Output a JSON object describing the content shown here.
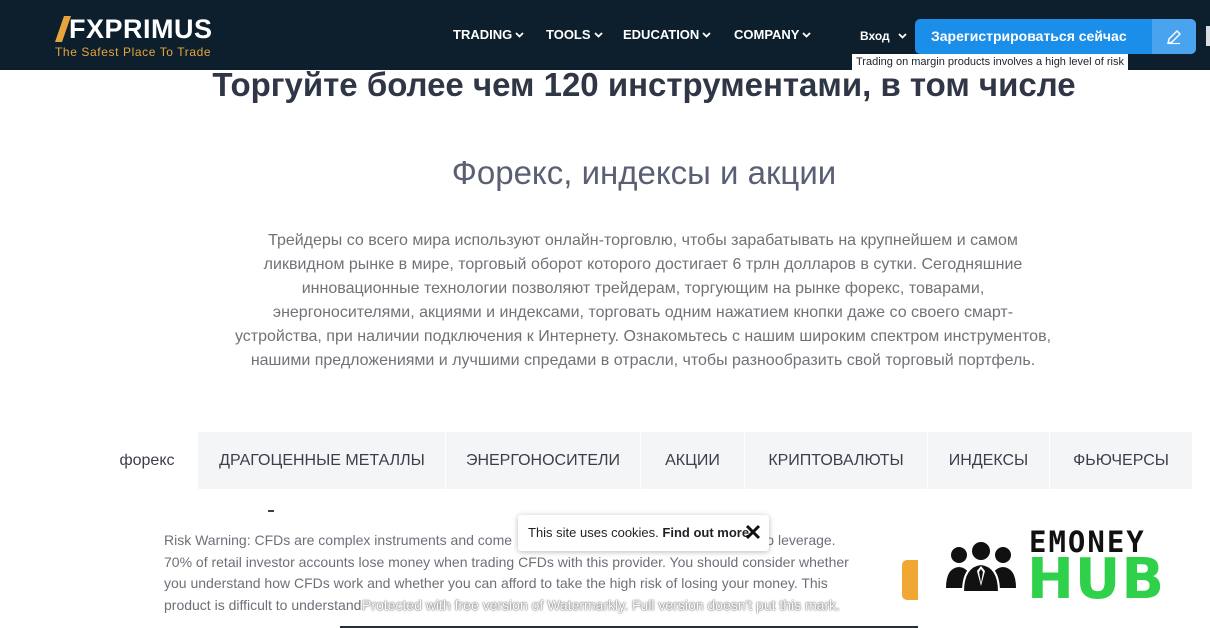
{
  "header": {
    "logo_name": "FXPRIMUS",
    "logo_tagline": "The Safest Place To Trade",
    "nav": [
      {
        "label": "TRADING"
      },
      {
        "label": "TOOLS"
      },
      {
        "label": "EDUCATION"
      },
      {
        "label": "COMPANY"
      }
    ],
    "login_label": "Вход",
    "register_label": "Зарегистрироваться сейчас",
    "edit_icon": "pencil-icon",
    "risk_strip": "Trading on margin products involves a high level of risk"
  },
  "hero": {
    "title": "Торгуйте более чем 120 инструментами, в том числе",
    "subtitle": "Форекс, индексы и акции",
    "description": "Трейдеры со всего мира используют онлайн-торговлю, чтобы зарабатывать на крупнейшем и самом ликвидном рынке в мире, торговый оборот которого достигает 6 трлн долларов в сутки. Сегодняшние инновационные технологии позволяют трейдерам, торгующим на рынке форекс, товарами, энергоносителями, акциями и индексами, торговать одним нажатием кнопки даже со своего смарт-устройства, при наличии подключения к Интернету. Ознакомьтесь с нашим широким спектром инструментов, нашими предложениями и лучшими спредами в отрасли, чтобы разнообразить свой торговый портфель."
  },
  "tabs": [
    {
      "label": "форекс",
      "active": true
    },
    {
      "label": "ДРАГОЦЕННЫЕ МЕТАЛЛЫ",
      "active": false
    },
    {
      "label": "ЭНЕРГОНОСИТЕЛИ",
      "active": false
    },
    {
      "label": "АКЦИИ",
      "active": false
    },
    {
      "label": "КРИПТОВАЛЮТЫ",
      "active": false
    },
    {
      "label": "ИНДЕКСЫ",
      "active": false
    },
    {
      "label": "ФЬЮЧЕРСЫ",
      "active": false
    }
  ],
  "risk_warning": {
    "line1_start": "Risk Warning: CFDs are complex instruments and come",
    "line1_end": "lly due to leverage.",
    "line2": "70% of retail investor accounts lose money when trading CFDs with this provider. You should consider whether",
    "line3": "you understand how CFDs work and whether you can afford to take the high risk of losing your money. This",
    "line4": "product is difficult to understand."
  },
  "cookie": {
    "text": "This site uses cookies.",
    "link": "Find out more",
    "close_icon": "close-icon"
  },
  "watermark": "Protected with free version of Watermarkly. Full version doesn't put this mark.",
  "badge": {
    "top": "EMONEY",
    "bottom": "HUB",
    "icon": "people-group-icon"
  },
  "colors": {
    "header_bg": "#0d1f2d",
    "brand_orange": "#e8a43c",
    "button_blue": "#1b8eea",
    "hub_green": "#2fd04a"
  }
}
